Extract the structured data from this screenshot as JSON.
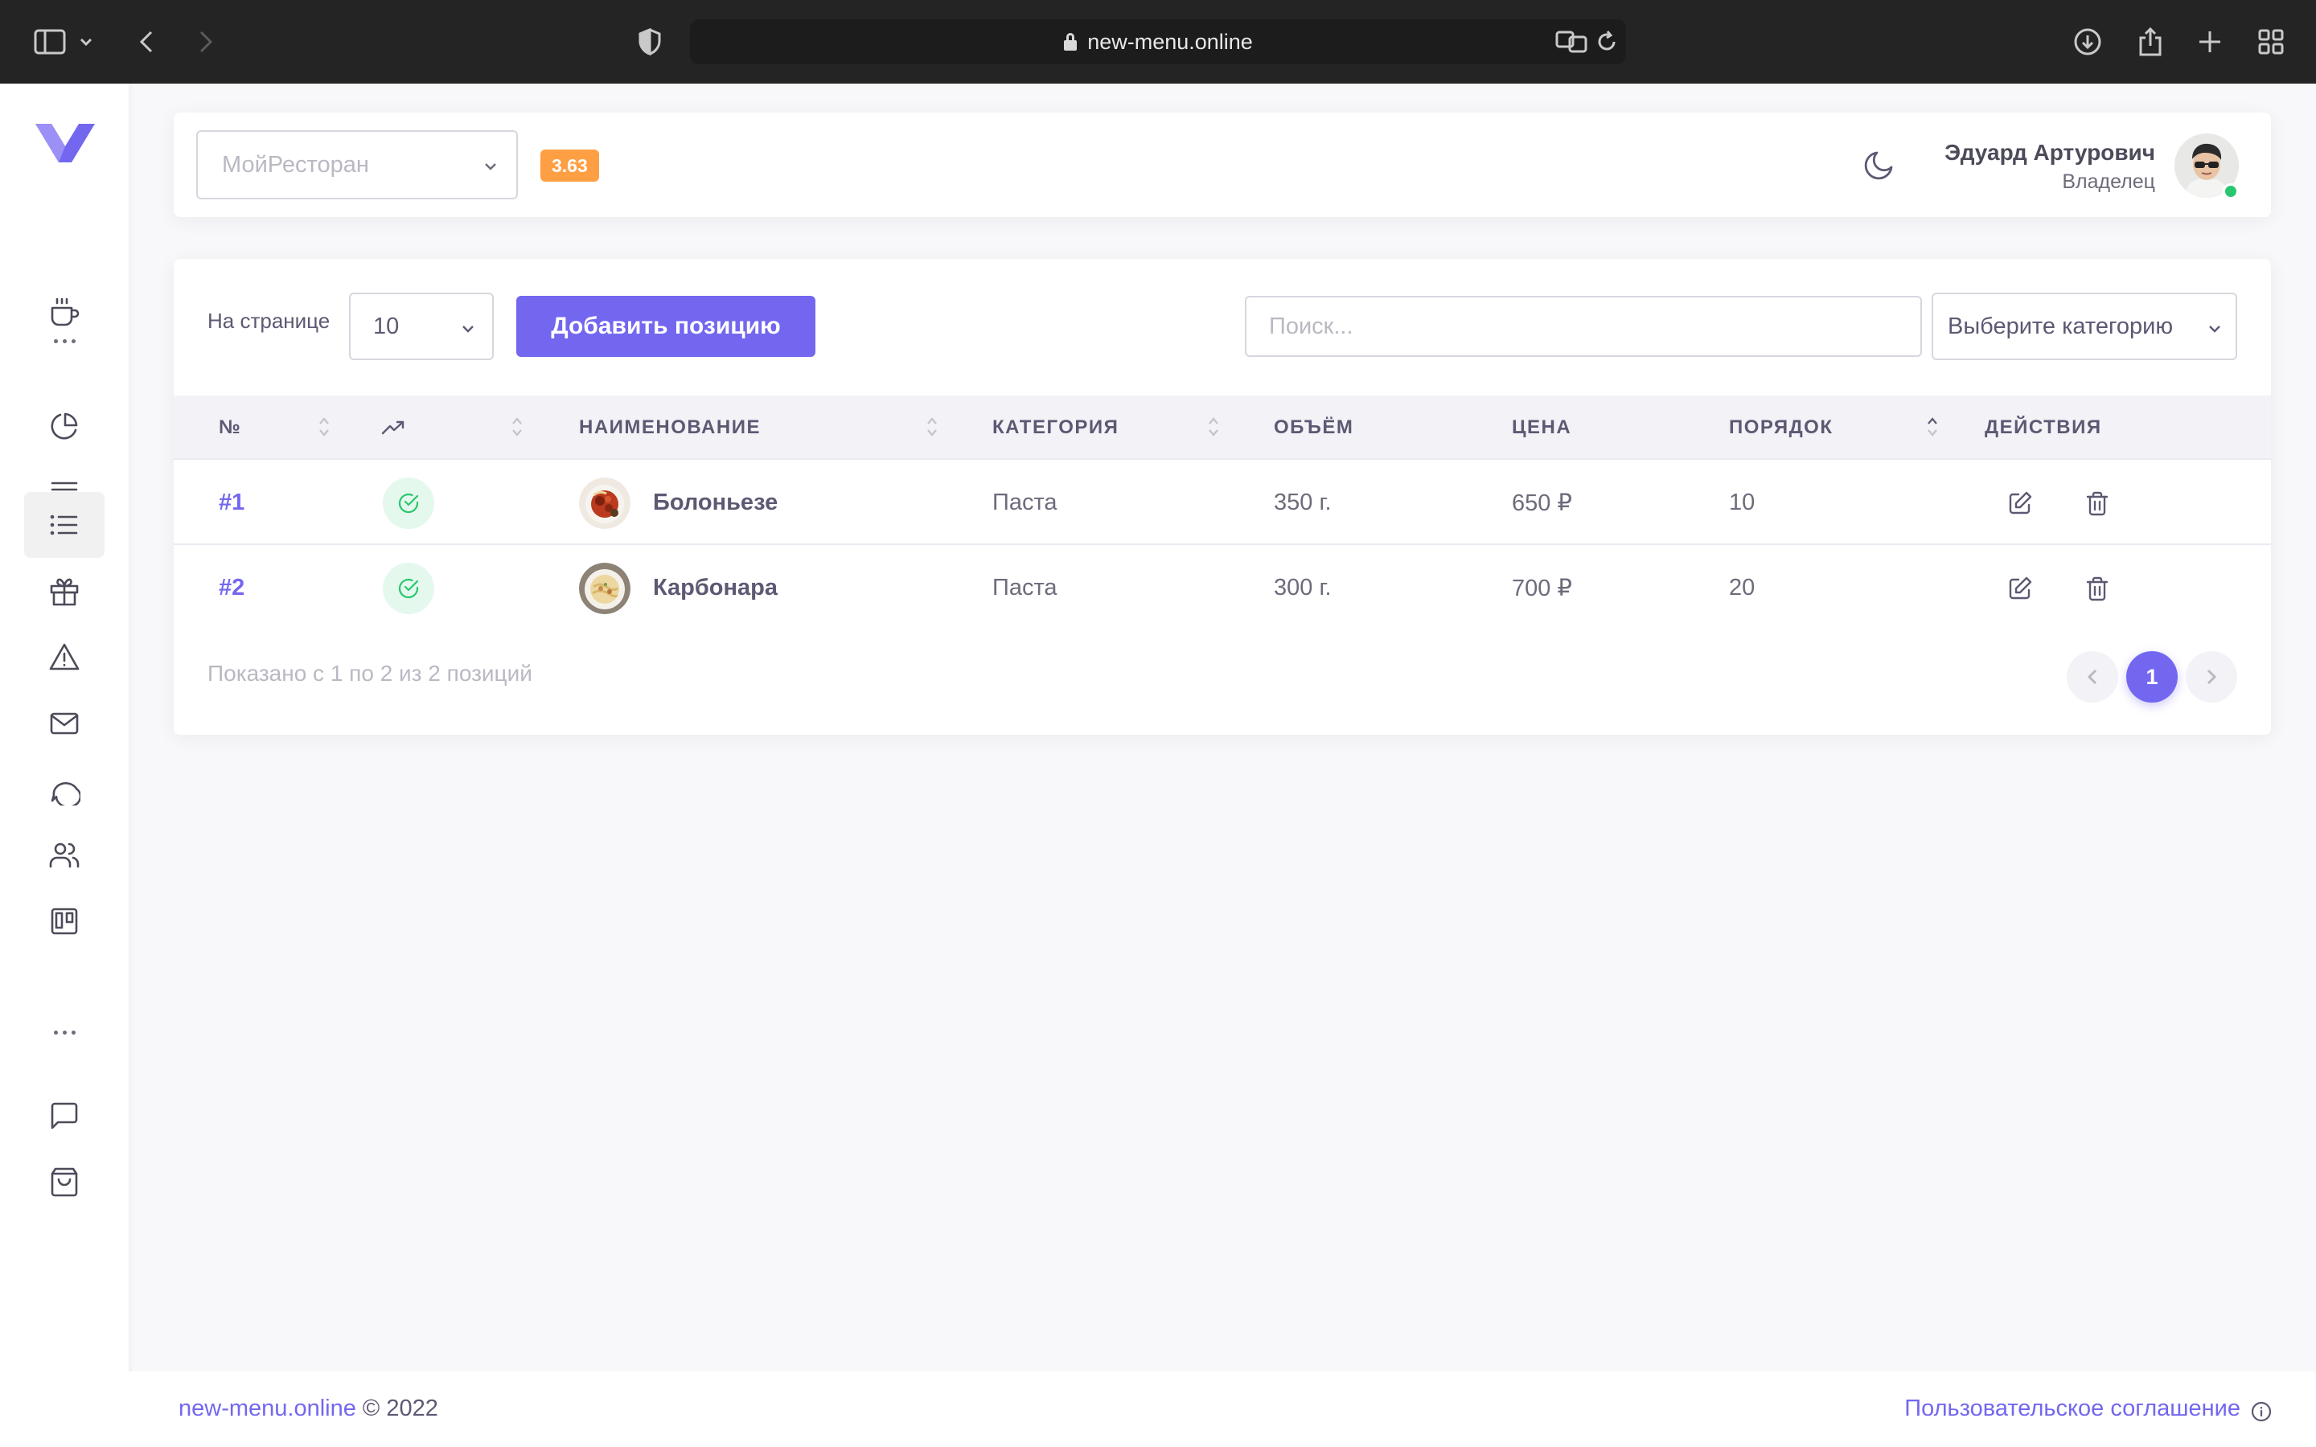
{
  "browser": {
    "url": "new-menu.online"
  },
  "header": {
    "restaurant_select": "МойРесторан",
    "version": "3.63",
    "user_name": "Эдуард Артурович",
    "user_role": "Владелец"
  },
  "toolbar": {
    "per_page_label": "На странице",
    "per_page_value": "10",
    "add_button": "Добавить позицию",
    "search_placeholder": "Поиск...",
    "category_select": "Выберите категорию"
  },
  "table": {
    "columns": {
      "num": "№",
      "name": "НАИМЕНОВАНИЕ",
      "category": "КАТЕГОРИЯ",
      "volume": "ОБЪЁМ",
      "price": "ЦЕНА",
      "order": "ПОРЯДОК",
      "actions": "ДЕЙСТВИЯ"
    },
    "rows": [
      {
        "id": "#1",
        "name": "Болоньезе",
        "category": "Паста",
        "volume": "350 г.",
        "price": "650 ₽",
        "order": "10"
      },
      {
        "id": "#2",
        "name": "Карбонара",
        "category": "Паста",
        "volume": "300 г.",
        "price": "700 ₽",
        "order": "20"
      }
    ],
    "summary": "Показано с 1 по 2 из 2 позиций",
    "current_page": "1"
  },
  "footer": {
    "site_link": "new-menu.online",
    "copyright": "© 2022",
    "agreement": "Пользовательское соглашение"
  },
  "colors": {
    "accent": "#7367f0",
    "badge": "#ff9f43",
    "success": "#28c76f"
  }
}
